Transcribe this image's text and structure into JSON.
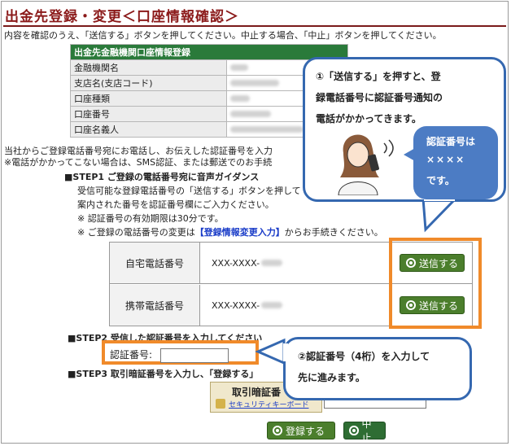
{
  "page": {
    "title": "出金先登録・変更＜口座情報確認＞",
    "intro": "内容を確認のうえ、「送信する」ボタンを押してください。中止する場合、「中止」ボタンを押してください。"
  },
  "account_info": {
    "header": "出金先金融機関口座情報登録",
    "rows": [
      {
        "label": "金融機関名"
      },
      {
        "label": "支店名(支店コード)"
      },
      {
        "label": "口座種類"
      },
      {
        "label": "口座番号"
      },
      {
        "label": "口座名義人"
      }
    ]
  },
  "notes": {
    "line1": "当社からご登録電話番号宛にお電話し、お伝えした認証番号を入力",
    "line2": "※電話がかかってこない場合は、SMS認証、または郵送でのお手続"
  },
  "step1": {
    "title": "■STEP1 ご登録の電話番号宛に音声ガイダンス",
    "desc1": "受信可能な登録電話番号の「送信する」ボタンを押して",
    "desc2": "案内された番号を認証番号欄にご入力ください。",
    "desc3": "※ 認証番号の有効期限は30分です。",
    "desc4_prefix": "※ ご登録の電話番号の変更は",
    "desc4_link": "【登録情報変更入力】",
    "desc4_suffix": "からお手続きください。"
  },
  "phones": [
    {
      "label": "自宅電話番号",
      "number": "XXX-XXXX-",
      "button": "送信する"
    },
    {
      "label": "携帯電話番号",
      "number": "XXX-XXXX-",
      "button": "送信する"
    }
  ],
  "step2": {
    "title": "■STEP2 受信した認証番号を入力してください",
    "input_label": "認証番号:",
    "input_value": ""
  },
  "step3": {
    "title": "■STEP3 取引暗証番号を入力し、「登録する」",
    "pwd_label": "取引暗証番",
    "security_keyboard": "セキュリティキーボード"
  },
  "buttons": {
    "register": "登録する",
    "cancel": "中止"
  },
  "callouts": {
    "top_line1": "①「送信する」を押すと、登",
    "top_line2": "録電話番号に認証番号通知の",
    "top_line3": "電話がかかってきます。",
    "inner_line1": "認証番号は",
    "inner_line2": "××××",
    "inner_line3": "です。",
    "bottom_line1": "②認証番号（4桁）を入力して",
    "bottom_line2": "先に進みます。"
  },
  "colors": {
    "title": "#8b1a1a",
    "header_green": "#2a7a3a",
    "button_green": "#4b7e2c",
    "highlight_orange": "#f08a2a",
    "callout_blue": "#3568b0",
    "link_blue": "#1a3cc8"
  }
}
